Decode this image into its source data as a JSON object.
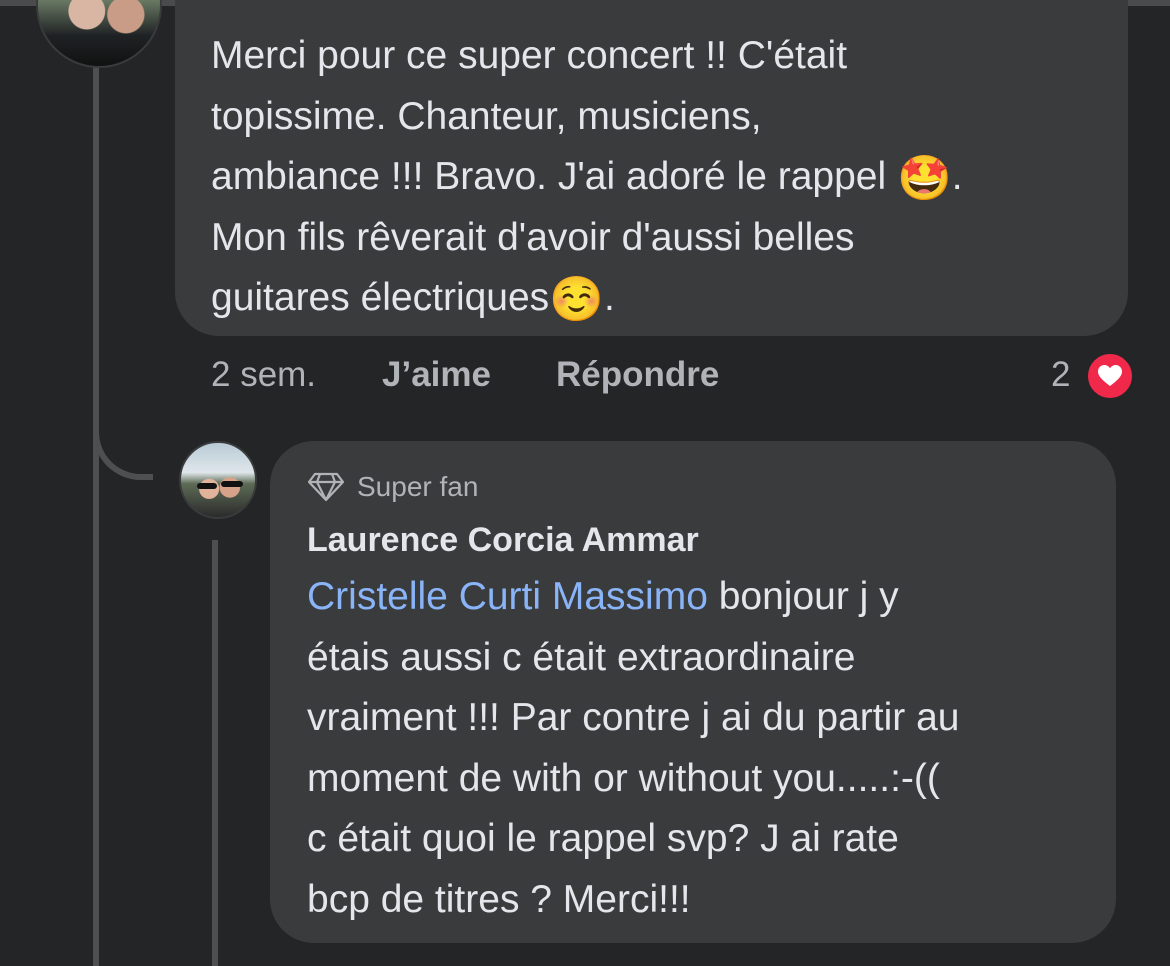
{
  "parent_comment": {
    "text_lines": [
      "Merci pour ce super concert !! C'était",
      "topissime. Chanteur, musiciens,",
      "ambiance !!! Bravo. J'ai adoré le rappel ",
      "Mon fils rêverait d'avoir d'aussi belles",
      "guitares électriques"
    ],
    "emoji_1": "🤩",
    "after_emoji_1": ".",
    "emoji_2": "☺️",
    "after_emoji_2": ".",
    "time": "2 sem.",
    "like_label": "J’aime",
    "reply_label": "Répondre",
    "reaction_count": "2",
    "reaction_icon": "heart-icon",
    "reaction_color": "#f02849"
  },
  "reply_comment": {
    "badge": "Super fan",
    "badge_icon": "diamond-icon",
    "author": "Laurence Corcia Ammar",
    "mention": "Cristelle Curti Massimo",
    "text_first": " bonjour j y",
    "text_lines": [
      "étais aussi c était extraordinaire",
      "vraiment !!! Par contre j ai du partir au",
      "moment de with or without you.....:-((",
      "c était quoi le rappel svp? J ai rate",
      "bcp de titres ? Merci!!!"
    ],
    "mention_color": "#8ab4f8"
  },
  "colors": {
    "background": "#242526",
    "bubble": "#3a3b3c",
    "text": "#e4e6eb",
    "secondary_text": "#b0b3b8"
  }
}
